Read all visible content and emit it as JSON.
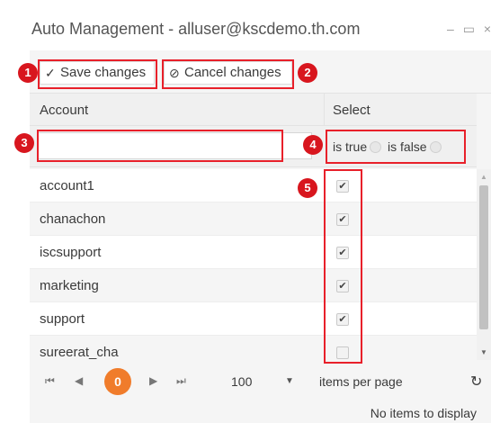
{
  "window": {
    "title": "Auto Management - alluser@kscdemo.th.com",
    "minimize": "–",
    "maximize": "▭",
    "close": "×"
  },
  "toolbar": {
    "save_label": "Save changes",
    "save_icon": "✓",
    "cancel_label": "Cancel changes",
    "cancel_icon": "⊘"
  },
  "grid": {
    "headers": {
      "account": "Account",
      "select": "Select"
    },
    "filter": {
      "account_value": "",
      "true_label": "is true",
      "false_label": "is false"
    },
    "rows": [
      {
        "account": "account1",
        "selected": true
      },
      {
        "account": "chanachon",
        "selected": true
      },
      {
        "account": "iscsupport",
        "selected": true
      },
      {
        "account": "marketing",
        "selected": true
      },
      {
        "account": "support",
        "selected": true
      },
      {
        "account": "sureerat_cha",
        "selected": false
      }
    ]
  },
  "pager": {
    "first": "⏮",
    "prev": "◀",
    "current_page": "0",
    "next": "▶",
    "last": "⏭",
    "page_size": "100",
    "items_per_page": "items per page",
    "refresh": "↻",
    "status": "No items to display"
  },
  "callouts": [
    "1",
    "2",
    "3",
    "4",
    "5"
  ],
  "colors": {
    "accent": "#f07c2b",
    "callout": "#d8161e"
  }
}
